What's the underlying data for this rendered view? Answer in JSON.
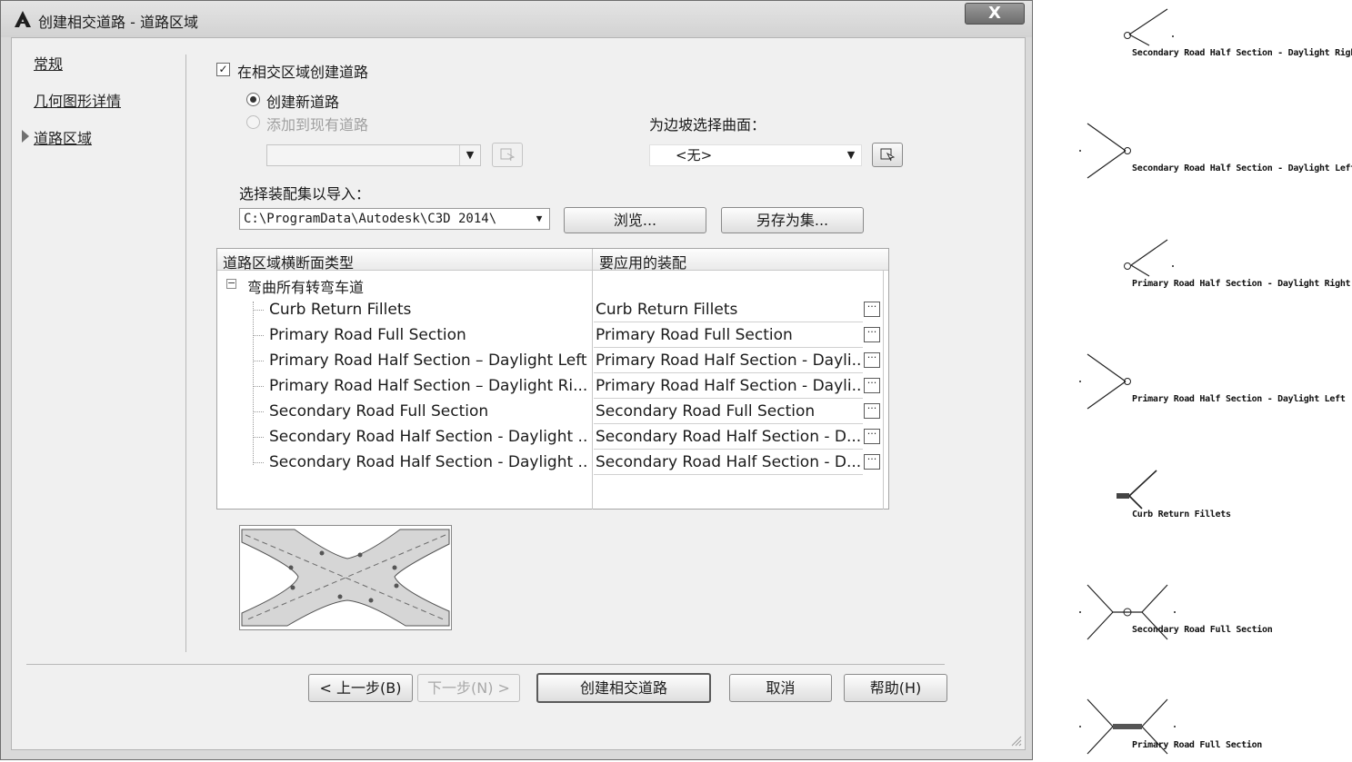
{
  "window": {
    "title": "创建相交道路 - 道路区域",
    "close_label": "X"
  },
  "nav": {
    "items": [
      "常规",
      "几何图形详情",
      "道路区域"
    ]
  },
  "options": {
    "create_in_region_label": "在相交区域创建道路",
    "create_in_region_checked": true,
    "radio_new_label": "创建新道路",
    "radio_add_label": "添加到现有道路",
    "slope_surface_label": "为边坡选择曲面：",
    "slope_surface_value": "<无>",
    "existing_corridor_value": ""
  },
  "import": {
    "label": "选择装配集以导入：",
    "path": "C:\\ProgramData\\Autodesk\\C3D 2014\\",
    "browse_label": "浏览...",
    "save_as_label": "另存为集..."
  },
  "grid": {
    "col_type": "道路区域横断面类型",
    "col_assembly": "要应用的装配",
    "group": "弯曲所有转弯车道",
    "rows": [
      {
        "type": "Curb Return Fillets",
        "assembly": "Curb Return Fillets"
      },
      {
        "type": "Primary Road Full Section",
        "assembly": "Primary Road Full Section"
      },
      {
        "type": "Primary Road Half Section – Daylight Left",
        "assembly": "Primary Road Half Section - Dayli..."
      },
      {
        "type": "Primary Road Half Section – Daylight Ri...",
        "assembly": "Primary Road Half Section - Dayli..."
      },
      {
        "type": "Secondary Road Full Section",
        "assembly": "Secondary Road Full Section"
      },
      {
        "type": "Secondary Road Half Section - Daylight ...",
        "assembly": "Secondary Road Half Section - D..."
      },
      {
        "type": "Secondary Road Half Section - Daylight ...",
        "assembly": "Secondary Road Half Section - D..."
      }
    ],
    "ellipsis_label": "···"
  },
  "buttons": {
    "back": "< 上一步(B)",
    "next": "下一步(N) >",
    "create": "创建相交道路",
    "cancel": "取消",
    "help": "帮助(H)"
  },
  "side_previews": [
    "Secondary Road Half Section - Daylight Right",
    "Secondary Road Half Section - Daylight Left",
    "Primary Road Half Section - Daylight Right",
    "Primary Road Half Section - Daylight Left",
    "Curb Return Fillets",
    "Secondary Road Full Section",
    "Primary Road Full Section"
  ]
}
